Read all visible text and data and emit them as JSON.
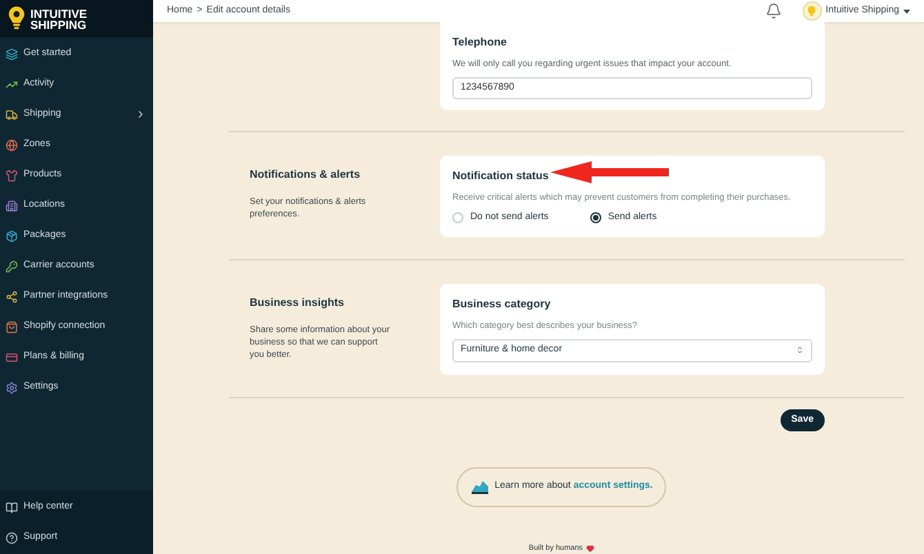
{
  "brand": {
    "name_line1": "INTUITIVE",
    "name_line2": "SHIPPING"
  },
  "sidebar": {
    "items": [
      {
        "label": "Get started",
        "expandable": false
      },
      {
        "label": "Activity",
        "expandable": false
      },
      {
        "label": "Shipping",
        "expandable": true
      },
      {
        "label": "Zones",
        "expandable": false
      },
      {
        "label": "Products",
        "expandable": false
      },
      {
        "label": "Locations",
        "expandable": false
      },
      {
        "label": "Packages",
        "expandable": false
      },
      {
        "label": "Carrier accounts",
        "expandable": false
      },
      {
        "label": "Partner integrations",
        "expandable": false
      },
      {
        "label": "Shopify connection",
        "expandable": false
      },
      {
        "label": "Plans & billing",
        "expandable": false
      },
      {
        "label": "Settings",
        "expandable": false
      }
    ],
    "footer_items": [
      {
        "label": "Help center"
      },
      {
        "label": "Support"
      }
    ]
  },
  "header": {
    "breadcrumb": {
      "home": "Home",
      "separator": ">",
      "current": "Edit account details"
    },
    "account": "Intuitive Shipping"
  },
  "telephone": {
    "title": "Telephone",
    "description": "We will only call you regarding urgent issues that impact your account.",
    "value": "1234567890"
  },
  "sections": [
    {
      "kind": "radio",
      "heading": "Notifications & alerts",
      "summary": "Set your notifications & alerts preferences.",
      "card_title": "Notification status",
      "card_description": "Receive critical alerts which may prevent customers from completing their purchases.",
      "options": [
        {
          "label": "Do not send alerts",
          "selected": false
        },
        {
          "label": "Send alerts",
          "selected": true
        }
      ]
    },
    {
      "kind": "select",
      "heading": "Business insights",
      "summary": "Share some information about your business so that we can support you better.",
      "card_title": "Business category",
      "card_description": "Which category best describes your business?",
      "value": "Furniture & home decor"
    }
  ],
  "save_button": "Save",
  "learn_more": {
    "text": "Learn more about",
    "link": "account settings."
  },
  "footer": {
    "text": "Built by humans"
  }
}
